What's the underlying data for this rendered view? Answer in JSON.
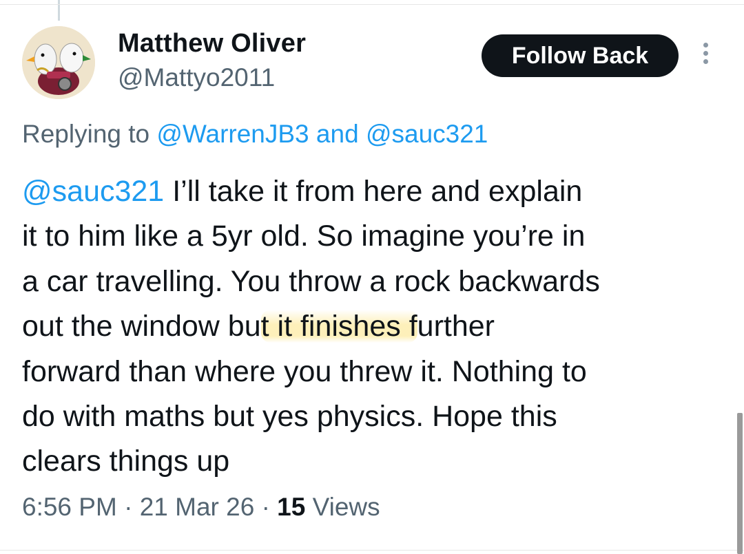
{
  "author": {
    "display_name": "Matthew Oliver",
    "handle": "@Mattyo2011"
  },
  "actions": {
    "follow_back_label": "Follow Back",
    "more_icon": "more-vertical-icon"
  },
  "replying": {
    "prefix": "Replying to",
    "user1": "@WarrenJB3",
    "conjunction": "and",
    "user2": "@sauc321"
  },
  "tweet": {
    "mention": "@sauc321",
    "line1_rest": "I’ll take it from here and explain",
    "line2": "it to him like a 5yr old. So imagine you’re in",
    "line3": "a car travelling. You throw a rock backwards",
    "line4_before": "out the window bu",
    "line4_highlight": "t it finishes f",
    "line4_after": "urther",
    "line5": "forward than where you threw it. Nothing to",
    "line6": "do with maths but yes physics. Hope this",
    "line7": "clears things up",
    "highlight_color": "#fce482"
  },
  "meta": {
    "time": "6:56 PM",
    "date": "21 Mar 26",
    "separator": "·",
    "views_count": "15",
    "views_label": "Views"
  },
  "colors": {
    "text": "#0f1419",
    "secondary": "#536471",
    "link": "#1d9bf0",
    "button_bg": "#0f1419"
  }
}
